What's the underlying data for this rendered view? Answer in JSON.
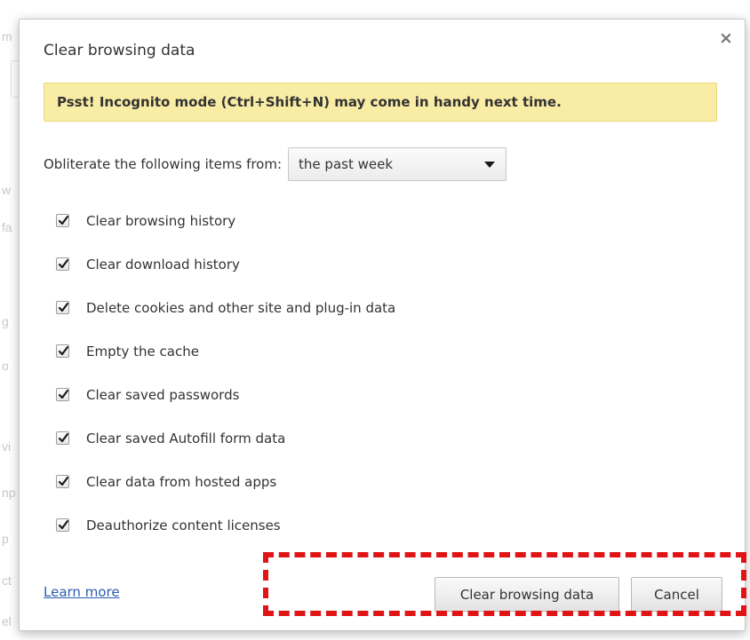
{
  "background": {
    "fragments": [
      "m",
      "w",
      "fa",
      "g",
      "o",
      "vi",
      "np",
      "p",
      "ct",
      "el"
    ]
  },
  "dialog": {
    "title": "Clear browsing data",
    "close_symbol": "×",
    "tip": "Psst! Incognito mode (Ctrl+Shift+N) may come in handy next time.",
    "period": {
      "label": "Obliterate the following items from:",
      "selected": "the past week"
    },
    "items": [
      {
        "label": "Clear browsing history",
        "checked": true
      },
      {
        "label": "Clear download history",
        "checked": true
      },
      {
        "label": "Delete cookies and other site and plug-in data",
        "checked": true
      },
      {
        "label": "Empty the cache",
        "checked": true
      },
      {
        "label": "Clear saved passwords",
        "checked": true
      },
      {
        "label": "Clear saved Autofill form data",
        "checked": true
      },
      {
        "label": "Clear data from hosted apps",
        "checked": true
      },
      {
        "label": "Deauthorize content licenses",
        "checked": true
      }
    ],
    "learn_more": "Learn more",
    "buttons": {
      "clear": "Clear browsing data",
      "cancel": "Cancel"
    }
  },
  "colors": {
    "tip_background": "#f9eda5",
    "link": "#2a5db0",
    "highlight": "#e01414"
  },
  "icons": {
    "close": "close-icon",
    "dropdown": "chevron-down-icon",
    "check": "checkmark-icon"
  }
}
